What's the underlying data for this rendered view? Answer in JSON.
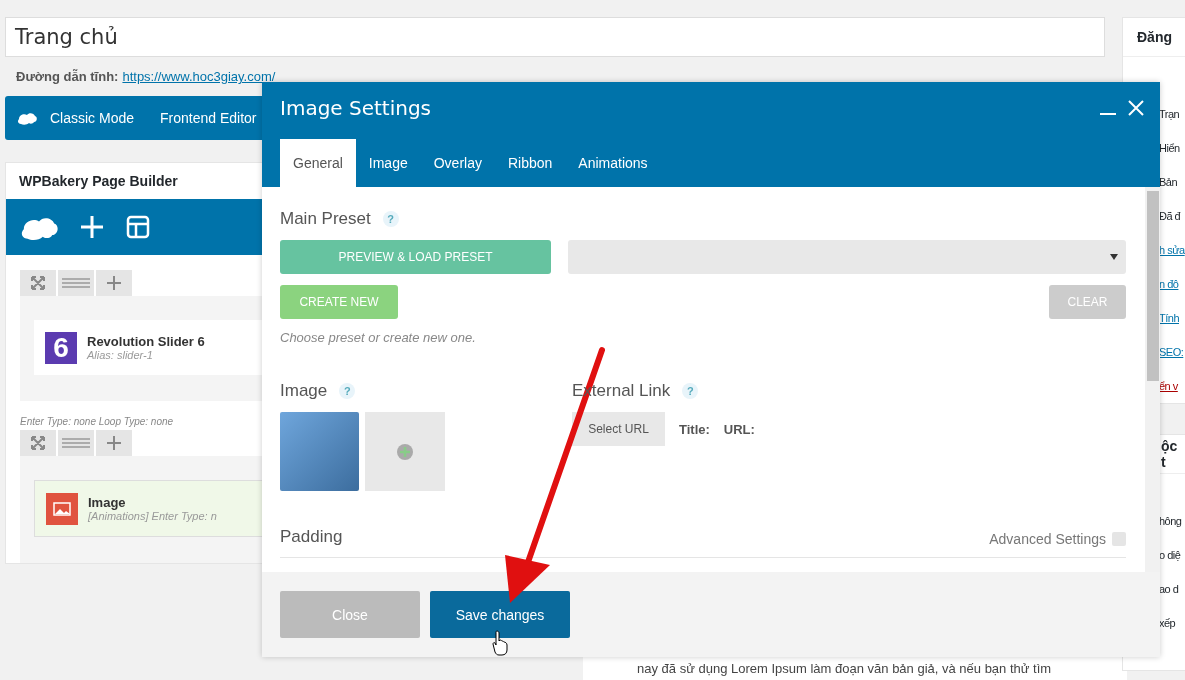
{
  "page": {
    "title_value": "Trang chủ",
    "permalink_label": "Đường dẫn tĩnh:",
    "permalink_url": "https://www.hoc3giay.com/",
    "editor_buttons": [
      "Classic Mode",
      "Frontend Editor"
    ],
    "builder": {
      "title": "WPBakery Page Builder",
      "rows": [
        {
          "kind": "slider",
          "caption": "",
          "name": "Revolution Slider 6",
          "meta": "Alias: slider-1",
          "badge": "6"
        },
        {
          "kind": "image",
          "caption": "Enter Type: none  Loop Type: none",
          "name": "Image",
          "meta": "[Animations] Enter Type: n",
          "badge": ""
        }
      ]
    },
    "content_text": "nay đã sử dụng Lorem Ipsum làm đoạn văn bản giả, và nếu bạn thử tìm"
  },
  "sidebar": {
    "title": "Đăng",
    "items": [
      {
        "text": "Trạn",
        "kind": "text"
      },
      {
        "text": "Hiển",
        "kind": "text"
      },
      {
        "text": "Bản",
        "kind": "text"
      },
      {
        "text": "Đã đ",
        "kind": "text"
      },
      {
        "text": "h sửa",
        "kind": "link"
      },
      {
        "text": "n đô",
        "kind": "link"
      },
      {
        "text": "Tính",
        "kind": "link"
      },
      {
        "text": "SEO:",
        "kind": "link"
      },
      {
        "text": "ển v",
        "kind": "danger"
      }
    ],
    "box2_title": "ộc t",
    "box2_items": [
      "hông",
      "o diệ",
      "ao d",
      "xếp"
    ]
  },
  "modal": {
    "title": "Image Settings",
    "tabs": [
      {
        "label": "General",
        "selected": true
      },
      {
        "label": "Image",
        "selected": false
      },
      {
        "label": "Overlay",
        "selected": false
      },
      {
        "label": "Ribbon",
        "selected": false
      },
      {
        "label": "Animations",
        "selected": false
      }
    ],
    "main_preset": {
      "heading": "Main Preset",
      "help": "?",
      "load_button": "PREVIEW & LOAD PRESET",
      "create_button": "CREATE NEW",
      "clear_button": "CLEAR",
      "hint": "Choose preset or create new one."
    },
    "image": {
      "heading": "Image",
      "help": "?"
    },
    "external_link": {
      "heading": "External Link",
      "help": "?",
      "button": "Select URL",
      "title_label": "Title:",
      "url_label": "URL:"
    },
    "padding": {
      "heading": "Padding",
      "advanced_label": "Advanced Settings",
      "advanced_checked": false
    },
    "buttons": {
      "close": "Close",
      "save": "Save changes"
    }
  }
}
